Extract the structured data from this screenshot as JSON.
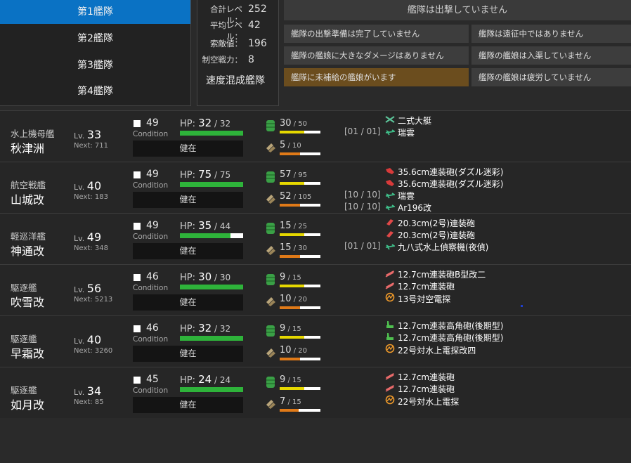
{
  "tabs": [
    "第1艦隊",
    "第2艦隊",
    "第3艦隊",
    "第4艦隊"
  ],
  "stats": {
    "total_level_label": "合計レベル：",
    "total_level": "252",
    "avg_level_label": "平均レベル：",
    "avg_level": "42",
    "los_label": "索敵値：",
    "los": "196",
    "air_label": "制空戦力：",
    "air": "8",
    "speed": "速度混成艦隊"
  },
  "status": {
    "header": "艦隊は出撃していません",
    "items": [
      "艦隊の出撃準備は完了していません",
      "艦隊は遠征中ではありません",
      "艦隊の艦娘に大きなダメージはありません",
      "艦隊の艦娘は入渠していません",
      "艦隊に未補給の艦娘がいます",
      "艦隊の艦娘は疲労していません"
    ]
  },
  "labels": {
    "lv": "Lv.",
    "next": "Next: ",
    "condition": "Condition",
    "hp": "HP: ",
    "healthy": "健在",
    "sep": " / "
  },
  "colors": {
    "accent": "#0a72c4",
    "hp": "#2eb33a",
    "fuel": "#e6d800",
    "ammo": "#e07a18",
    "warn": "#6b4d1e"
  },
  "ships": [
    {
      "type": "水上機母艦",
      "name": "秋津洲",
      "lv": "33",
      "next": "711",
      "cond": "49",
      "hp": "32",
      "hpmax": "32",
      "hpfrac": 1.0,
      "fuel": "30",
      "fuelmax": "50",
      "fuelfrac": 0.6,
      "ammo": "5",
      "ammomax": "10",
      "ammofrac": 0.5,
      "slots": [
        {
          "icon": "flying-boat-icon",
          "name": "二式大艇",
          "onslot": ""
        },
        {
          "icon": "seaplane-icon",
          "name": "瑞雲",
          "onslot": "[01 / 01]"
        }
      ]
    },
    {
      "type": "航空戦艦",
      "name": "山城改",
      "lv": "40",
      "next": "183",
      "cond": "49",
      "hp": "75",
      "hpmax": "75",
      "hpfrac": 1.0,
      "fuel": "57",
      "fuelmax": "95",
      "fuelfrac": 0.6,
      "ammo": "52",
      "ammomax": "105",
      "ammofrac": 0.5,
      "slots": [
        {
          "icon": "large-gun-icon",
          "name": "35.6cm連装砲(ダズル迷彩)",
          "onslot": ""
        },
        {
          "icon": "large-gun-icon",
          "name": "35.6cm連装砲(ダズル迷彩)",
          "onslot": ""
        },
        {
          "icon": "seaplane-icon",
          "name": "瑞雲",
          "onslot": "[10 / 10]"
        },
        {
          "icon": "seaplane-icon",
          "name": "Ar196改",
          "onslot": "[10 / 10]"
        }
      ]
    },
    {
      "type": "軽巡洋艦",
      "name": "神通改",
      "lv": "49",
      "next": "348",
      "cond": "49",
      "hp": "35",
      "hpmax": "44",
      "hpfrac": 0.795,
      "fuel": "15",
      "fuelmax": "25",
      "fuelfrac": 0.6,
      "ammo": "15",
      "ammomax": "30",
      "ammofrac": 0.5,
      "slots": [
        {
          "icon": "medium-gun-icon",
          "name": "20.3cm(2号)連装砲",
          "onslot": ""
        },
        {
          "icon": "medium-gun-icon",
          "name": "20.3cm(2号)連装砲",
          "onslot": ""
        },
        {
          "icon": "seaplane-icon",
          "name": "九八式水上偵察機(夜偵)",
          "onslot": "[01 / 01]"
        }
      ]
    },
    {
      "type": "駆逐艦",
      "name": "吹雪改",
      "lv": "56",
      "next": "5213",
      "cond": "46",
      "hp": "30",
      "hpmax": "30",
      "hpfrac": 1.0,
      "fuel": "9",
      "fuelmax": "15",
      "fuelfrac": 0.6,
      "ammo": "10",
      "ammomax": "20",
      "ammofrac": 0.5,
      "slots": [
        {
          "icon": "small-gun-icon",
          "name": "12.7cm連装砲B型改二",
          "onslot": ""
        },
        {
          "icon": "small-gun-icon",
          "name": "12.7cm連装砲",
          "onslot": ""
        },
        {
          "icon": "radar-icon",
          "name": "13号対空電探",
          "onslot": ""
        }
      ]
    },
    {
      "type": "駆逐艦",
      "name": "早霜改",
      "lv": "40",
      "next": "3260",
      "cond": "46",
      "hp": "32",
      "hpmax": "32",
      "hpfrac": 1.0,
      "fuel": "9",
      "fuelmax": "15",
      "fuelfrac": 0.6,
      "ammo": "10",
      "ammomax": "20",
      "ammofrac": 0.5,
      "slots": [
        {
          "icon": "high-angle-gun-icon",
          "name": "12.7cm連装高角砲(後期型)",
          "onslot": ""
        },
        {
          "icon": "high-angle-gun-icon",
          "name": "12.7cm連装高角砲(後期型)",
          "onslot": ""
        },
        {
          "icon": "radar-icon",
          "name": "22号対水上電探改四",
          "onslot": ""
        }
      ]
    },
    {
      "type": "駆逐艦",
      "name": "如月改",
      "lv": "34",
      "next": "85",
      "cond": "45",
      "hp": "24",
      "hpmax": "24",
      "hpfrac": 1.0,
      "fuel": "9",
      "fuelmax": "15",
      "fuelfrac": 0.6,
      "ammo": "7",
      "ammomax": "15",
      "ammofrac": 0.47,
      "slots": [
        {
          "icon": "small-gun-icon",
          "name": "12.7cm連装砲",
          "onslot": ""
        },
        {
          "icon": "small-gun-icon",
          "name": "12.7cm連装砲",
          "onslot": ""
        },
        {
          "icon": "radar-icon",
          "name": "22号対水上電探",
          "onslot": ""
        }
      ]
    }
  ]
}
